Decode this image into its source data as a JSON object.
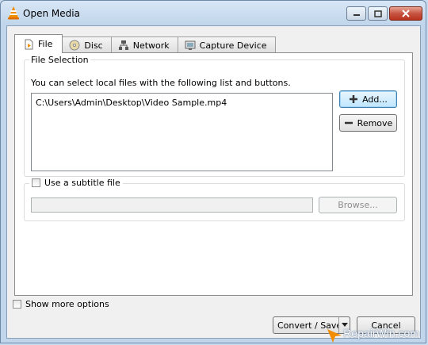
{
  "window": {
    "title": "Open Media"
  },
  "tabs": [
    {
      "label": "File"
    },
    {
      "label": "Disc"
    },
    {
      "label": "Network"
    },
    {
      "label": "Capture Device"
    }
  ],
  "file_selection": {
    "title": "File Selection",
    "hint": "You can select local files with the following list and buttons.",
    "files": [
      "C:\\Users\\Admin\\Desktop\\Video Sample.mp4"
    ],
    "add_label": "Add...",
    "remove_label": "Remove"
  },
  "subtitle": {
    "label": "Use a subtitle file",
    "checked": false,
    "path": "",
    "browse_label": "Browse..."
  },
  "more_options": {
    "label": "Show more options",
    "checked": false
  },
  "footer": {
    "convert_label": "Convert / Save",
    "cancel_label": "Cancel"
  },
  "watermark": "RepairWin.com",
  "colors": {
    "accent": "#3c7fb1",
    "close": "#c75542",
    "vlc_orange": "#f28c00"
  }
}
